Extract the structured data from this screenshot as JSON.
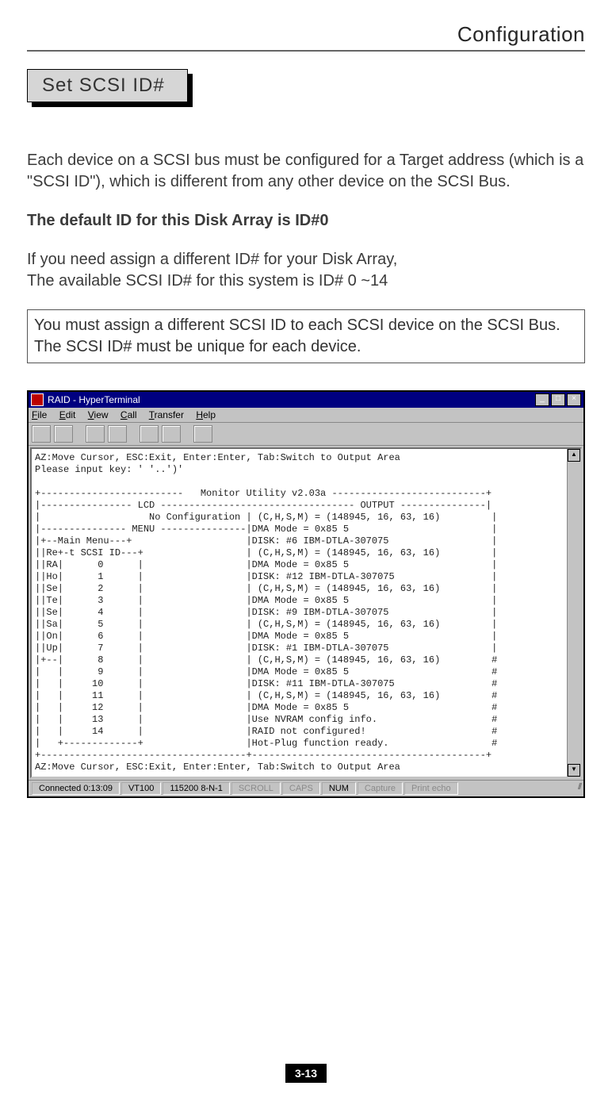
{
  "header": {
    "title": "Configuration"
  },
  "section": {
    "label": "Set  SCSI  ID#"
  },
  "body": {
    "p1": "Each device on a SCSI bus must be configured for a Target address (which is a \"SCSI ID\"), which is different from any other device on the SCSI Bus.",
    "p2": "The default ID for this Disk Array is ID#0",
    "p3a": "If you need assign a different ID# for your Disk Array,",
    "p3b": "The available SCSI ID# for this system is ID# 0 ~14",
    "note": "You must assign a different SCSI ID to each SCSI device on the SCSI Bus. The SCSI ID# must be unique for each device."
  },
  "hyperterminal": {
    "title": "RAID - HyperTerminal",
    "menu": {
      "file": "File",
      "edit": "Edit",
      "view": "View",
      "call": "Call",
      "transfer": "Transfer",
      "help": "Help"
    },
    "winbtns": {
      "min": "_",
      "max": "□",
      "close": "×"
    },
    "scroll": {
      "up": "▲",
      "down": "▼"
    },
    "status": {
      "conn": "Connected 0:13:09",
      "emul": "VT100",
      "line": "115200 8-N-1",
      "scroll": "SCROLL",
      "caps": "CAPS",
      "num": "NUM",
      "capture": "Capture",
      "echo": "Print echo"
    },
    "terminal": "AZ:Move Cursor, ESC:Exit, Enter:Enter, Tab:Switch to Output Area\nPlease input key: ' '..')'\n\n+-------------------------   Monitor Utility v2.03a ---------------------------+\n|---------------- LCD ---------------------------------- OUTPUT ---------------|\n|                   No Configuration | (C,H,S,M) = (148945, 16, 63, 16)         |\n|--------------- MENU ---------------|DMA Mode = 0x85 5                         |\n|+--Main Menu---+                    |DISK: #6 IBM-DTLA-307075                  |\n||Re+-t SCSI ID---+                  | (C,H,S,M) = (148945, 16, 63, 16)         |\n||RA|      0      |                  |DMA Mode = 0x85 5                         |\n||Ho|      1      |                  |DISK: #12 IBM-DTLA-307075                 |\n||Se|      2      |                  | (C,H,S,M) = (148945, 16, 63, 16)         |\n||Te|      3      |                  |DMA Mode = 0x85 5                         |\n||Se|      4      |                  |DISK: #9 IBM-DTLA-307075                  |\n||Sa|      5      |                  | (C,H,S,M) = (148945, 16, 63, 16)         |\n||On|      6      |                  |DMA Mode = 0x85 5                         |\n||Up|      7      |                  |DISK: #1 IBM-DTLA-307075                  |\n|+--|      8      |                  | (C,H,S,M) = (148945, 16, 63, 16)         #\n|   |      9      |                  |DMA Mode = 0x85 5                         #\n|   |     10      |                  |DISK: #11 IBM-DTLA-307075                 #\n|   |     11      |                  | (C,H,S,M) = (148945, 16, 63, 16)         #\n|   |     12      |                  |DMA Mode = 0x85 5                         #\n|   |     13      |                  |Use NVRAM config info.                    #\n|   |     14      |                  |RAID not configured!                      #\n|   +-------------+                  |Hot-Plug function ready.                  #\n+------------------------------------+-----------------------------------------+\nAZ:Move Cursor, ESC:Exit, Enter:Enter, Tab:Switch to Output Area"
  },
  "page_number": "3-13"
}
